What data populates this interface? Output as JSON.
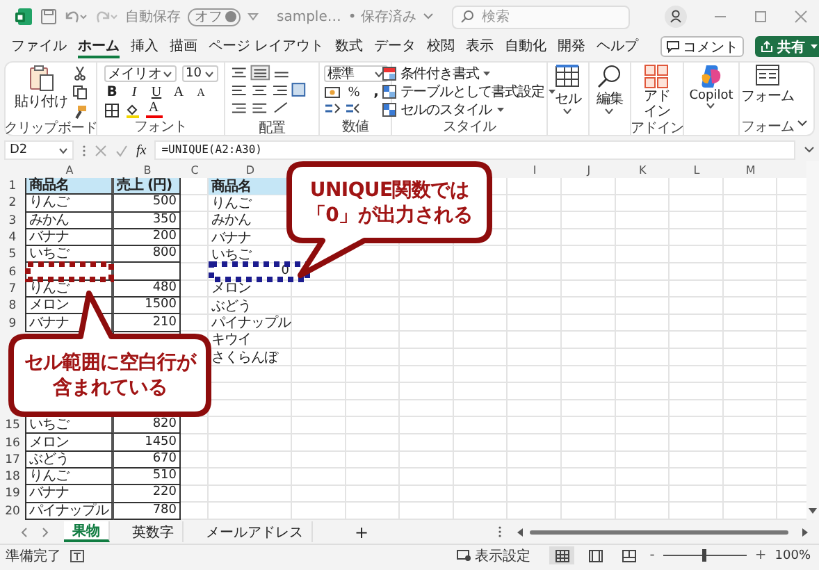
{
  "title_bar": {
    "autosave_label": "自動保存",
    "autosave_toggle": "オフ",
    "autosave_on": false,
    "filename": "sample…",
    "saved_status": "• 保存済み",
    "search_placeholder": "検索"
  },
  "menu_tabs": [
    {
      "label": "ファイル",
      "selected": false
    },
    {
      "label": "ホーム",
      "selected": true
    },
    {
      "label": "挿入",
      "selected": false
    },
    {
      "label": "描画",
      "selected": false
    },
    {
      "label": "ページ レイアウト",
      "selected": false
    },
    {
      "label": "数式",
      "selected": false
    },
    {
      "label": "データ",
      "selected": false
    },
    {
      "label": "校閲",
      "selected": false
    },
    {
      "label": "表示",
      "selected": false
    },
    {
      "label": "自動化",
      "selected": false
    },
    {
      "label": "開発",
      "selected": false
    },
    {
      "label": "ヘルプ",
      "selected": false
    }
  ],
  "comment_button": "コメント",
  "share_button": "共有",
  "ribbon": {
    "groups": [
      {
        "kind": "clipboard",
        "label": "クリップボード",
        "button": "貼り付け"
      },
      {
        "kind": "font",
        "label": "フォント",
        "font_name": "メイリオ",
        "font_size": "10",
        "bold": "B",
        "italic": "I",
        "underline": "U",
        "grow": "A",
        "shrink": "A",
        "font_color": "A"
      },
      {
        "kind": "alignment",
        "label": "配置"
      },
      {
        "kind": "number",
        "label": "数値",
        "format": "標準",
        "percent": "%",
        "comma": ","
      },
      {
        "kind": "styles",
        "label": "スタイル",
        "items": [
          "条件付き書式",
          "テーブルとして書式設定",
          "セルのスタイル"
        ]
      },
      {
        "kind": "cells",
        "button": "セル"
      },
      {
        "kind": "editing",
        "button": "編集"
      },
      {
        "kind": "addins",
        "label": "アドイン",
        "button_lines": [
          "アド",
          "イン"
        ]
      },
      {
        "kind": "copilot",
        "button": "Copilot"
      },
      {
        "kind": "form",
        "label": "フォーム",
        "button": "フォーム"
      }
    ]
  },
  "formula_bar": {
    "name_box": "D2",
    "fx": "fx",
    "formula": "=UNIQUE(A2:A30)"
  },
  "columns": [
    {
      "label": "A",
      "table_border": true
    },
    {
      "label": "B",
      "table_border": true
    },
    {
      "label": "C"
    },
    {
      "label": "D"
    },
    {},
    {},
    {},
    {},
    {
      "label": "I"
    },
    {
      "label": "J"
    },
    {
      "label": "K"
    },
    {
      "label": "L"
    },
    {
      "label": "M"
    }
  ],
  "rows": [
    {
      "number": "1",
      "kind": "header",
      "a": "商品名",
      "b": "売上 (円)",
      "d": "商品名"
    },
    {
      "number": "2",
      "a": "りんご",
      "b": "500",
      "d": "りんご"
    },
    {
      "number": "3",
      "a": "みかん",
      "b": "350",
      "d": "みかん"
    },
    {
      "number": "4",
      "a": "バナナ",
      "b": "200",
      "d": "バナナ"
    },
    {
      "number": "5",
      "a": "いちご",
      "b": "800",
      "d": "いちご"
    },
    {
      "number": "6",
      "d": "0"
    },
    {
      "number": "7",
      "a": "りんご",
      "b": "480",
      "d": "メロン"
    },
    {
      "number": "8",
      "a": "メロン",
      "b": "1500",
      "d": "ぶどう"
    },
    {
      "number": "9",
      "a": "バナナ",
      "b": "210",
      "d": "パイナップル"
    },
    {
      "d": "キウイ"
    },
    {
      "d": "さくらんぼ"
    },
    {},
    {},
    {},
    {
      "number": "15",
      "a": "いちご",
      "b": "820"
    },
    {
      "number": "16",
      "a": "メロン",
      "b": "1450"
    },
    {
      "number": "17",
      "a": "ぶどう",
      "b": "670"
    },
    {
      "number": "18",
      "a": "りんご",
      "b": "510"
    },
    {
      "number": "19",
      "a": "バナナ",
      "b": "220"
    },
    {
      "number": "20",
      "a": "パイナップル",
      "b": "780"
    }
  ],
  "annotations": {
    "callouts": [
      {
        "lines": [
          "UNIQUE関数では",
          "「0」が出力される"
        ]
      },
      {
        "lines": [
          "セル範囲に空白行が",
          "含まれている"
        ]
      }
    ],
    "highlights": [
      {
        "color": "#9b1010"
      },
      {
        "color": "#1c1c8f"
      }
    ]
  },
  "sheet_tabs": [
    {
      "label": "果物",
      "selected": true
    },
    {
      "label": "英数字",
      "selected": false
    },
    {
      "label": "メールアドレス",
      "selected": false
    }
  ],
  "add_sheet": "+",
  "status_bar": {
    "status": "準備完了",
    "display_settings": "表示設定",
    "views": [
      {
        "selected": true
      },
      {
        "selected": false
      },
      {
        "selected": false
      }
    ],
    "zoom_out": "-",
    "zoom_in": "+",
    "zoom": "100%",
    "zoom_slider": {
      "level": 0.5
    }
  }
}
